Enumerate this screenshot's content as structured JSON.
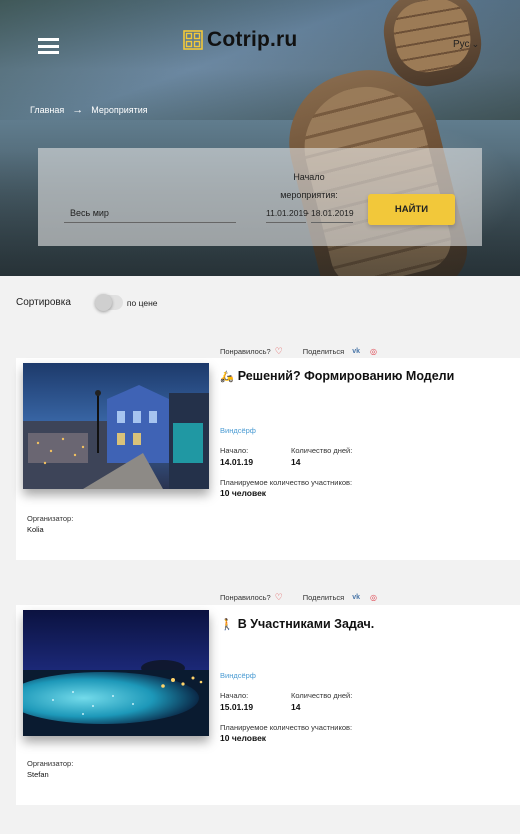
{
  "header": {
    "logo_text": "Cotrip.ru",
    "language": "Рус",
    "brand_color": "#f2c83a"
  },
  "breadcrumb": {
    "home": "Главная",
    "current": "Мероприятия"
  },
  "search": {
    "location": "Весь мир",
    "date_caption_line1": "Начало",
    "date_caption_line2": "мероприятия:",
    "date_from": "11.01.2019",
    "date_to": "18.01.2019",
    "find_label": "НАЙТИ"
  },
  "sort": {
    "label": "Сортировка",
    "price_label": "по цене"
  },
  "events": [
    {
      "liked_label": "Понравилось?",
      "share_label": "Поделиться",
      "vk": "vk",
      "title": "Решений? Формированию Модели",
      "category": "Виндсёрф",
      "start_label": "Начало:",
      "start_value": "14.01.19",
      "days_label": "Количество дней:",
      "days_value": "14",
      "participants_label": "Планируемое количество участников:",
      "participants_value": "10 человек",
      "organizer_label": "Организатор:",
      "organizer_value": "Kolia"
    },
    {
      "liked_label": "Понравилось?",
      "share_label": "Поделиться",
      "vk": "vk",
      "title": "В Участниками Задач.",
      "category": "Виндсёрф",
      "start_label": "Начало:",
      "start_value": "15.01.19",
      "days_label": "Количество дней:",
      "days_value": "14",
      "participants_label": "Планируемое количество участников:",
      "participants_value": "10 человек",
      "organizer_label": "Организатор:",
      "organizer_value": "Stefan"
    }
  ]
}
